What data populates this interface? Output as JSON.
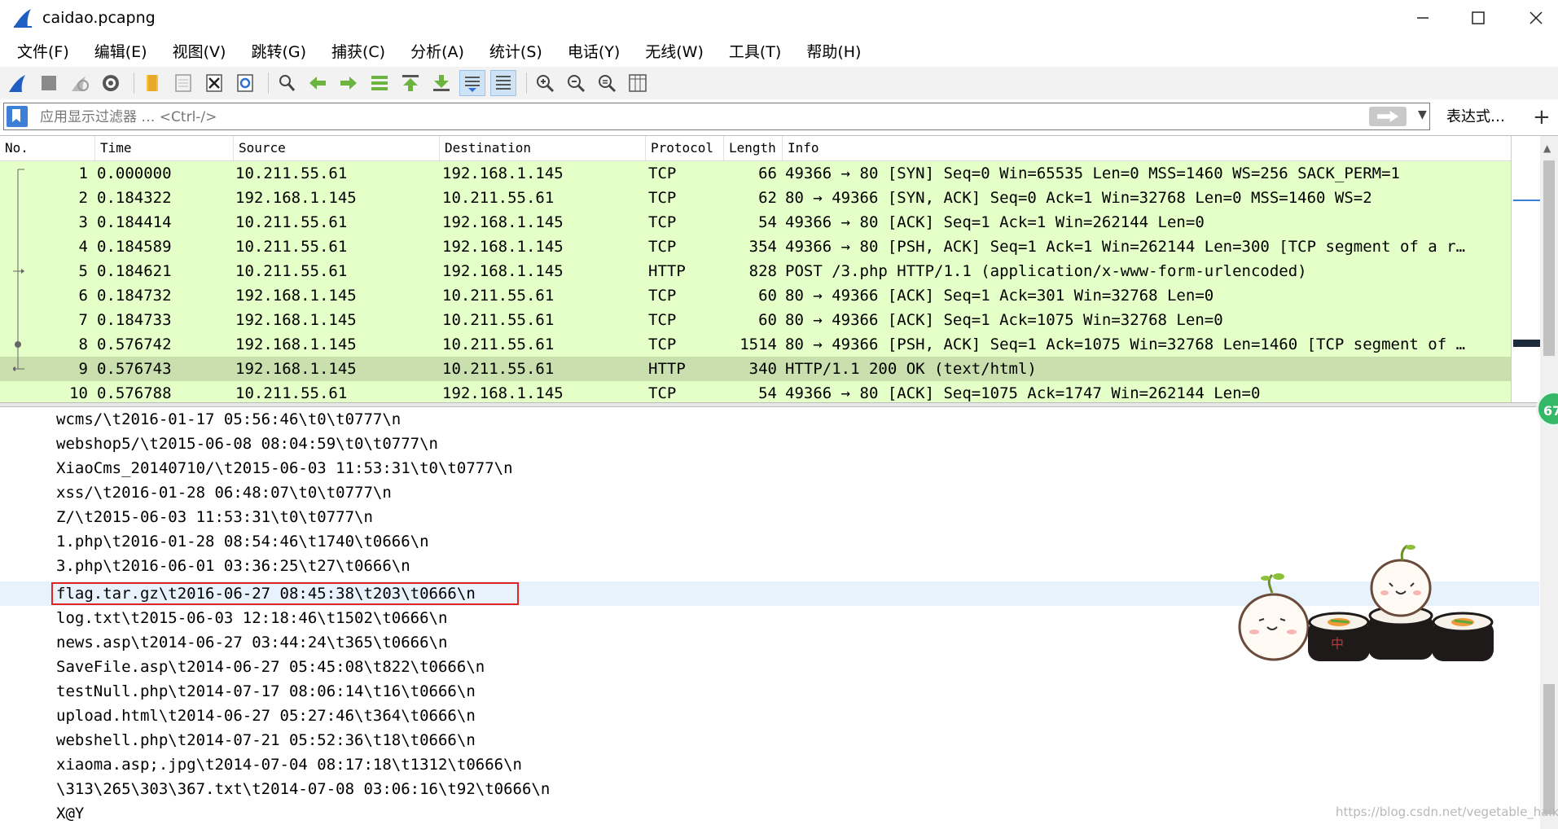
{
  "window": {
    "title": "caidao.pcapng",
    "minimize": "—",
    "maximize": "☐",
    "close": "✕"
  },
  "menu": [
    {
      "label": "文件(F)"
    },
    {
      "label": "编辑(E)"
    },
    {
      "label": "视图(V)"
    },
    {
      "label": "跳转(G)"
    },
    {
      "label": "捕获(C)"
    },
    {
      "label": "分析(A)"
    },
    {
      "label": "统计(S)"
    },
    {
      "label": "电话(Y)"
    },
    {
      "label": "无线(W)"
    },
    {
      "label": "工具(T)"
    },
    {
      "label": "帮助(H)"
    }
  ],
  "toolbar": {
    "icons": [
      "shark-fin-start-icon",
      "stop-capture-icon",
      "restart-capture-icon",
      "capture-options-icon",
      "open-file-icon",
      "save-file-icon",
      "close-file-icon",
      "reload-file-icon",
      "find-packet-icon",
      "go-back-icon",
      "go-forward-icon",
      "go-to-packet-icon",
      "first-packet-icon",
      "last-packet-icon",
      "autoscroll-icon",
      "colorize-icon",
      "zoom-in-icon",
      "zoom-out-icon",
      "zoom-normal-icon",
      "resize-columns-icon"
    ]
  },
  "filter": {
    "placeholder": "应用显示过滤器 … <Ctrl-/>",
    "value": "",
    "expression_label": "表达式…",
    "add_label": "+"
  },
  "packet_list": {
    "columns": [
      "No.",
      "Time",
      "Source",
      "Destination",
      "Protocol",
      "Length",
      "Info"
    ],
    "rows": [
      {
        "no": "1",
        "time": "0.000000",
        "src": "10.211.55.61",
        "dst": "192.168.1.145",
        "proto": "TCP",
        "len": "66",
        "info": "49366 → 80 [SYN] Seq=0 Win=65535 Len=0 MSS=1460 WS=256 SACK_PERM=1"
      },
      {
        "no": "2",
        "time": "0.184322",
        "src": "192.168.1.145",
        "dst": "10.211.55.61",
        "proto": "TCP",
        "len": "62",
        "info": "80 → 49366 [SYN, ACK] Seq=0 Ack=1 Win=32768 Len=0 MSS=1460 WS=2"
      },
      {
        "no": "3",
        "time": "0.184414",
        "src": "10.211.55.61",
        "dst": "192.168.1.145",
        "proto": "TCP",
        "len": "54",
        "info": "49366 → 80 [ACK] Seq=1 Ack=1 Win=262144 Len=0"
      },
      {
        "no": "4",
        "time": "0.184589",
        "src": "10.211.55.61",
        "dst": "192.168.1.145",
        "proto": "TCP",
        "len": "354",
        "info": "49366 → 80 [PSH, ACK] Seq=1 Ack=1 Win=262144 Len=300 [TCP segment of a r…"
      },
      {
        "no": "5",
        "time": "0.184621",
        "src": "10.211.55.61",
        "dst": "192.168.1.145",
        "proto": "HTTP",
        "len": "828",
        "info": "POST /3.php HTTP/1.1  (application/x-www-form-urlencoded)"
      },
      {
        "no": "6",
        "time": "0.184732",
        "src": "192.168.1.145",
        "dst": "10.211.55.61",
        "proto": "TCP",
        "len": "60",
        "info": "80 → 49366 [ACK] Seq=1 Ack=301 Win=32768 Len=0"
      },
      {
        "no": "7",
        "time": "0.184733",
        "src": "192.168.1.145",
        "dst": "10.211.55.61",
        "proto": "TCP",
        "len": "60",
        "info": "80 → 49366 [ACK] Seq=1 Ack=1075 Win=32768 Len=0"
      },
      {
        "no": "8",
        "time": "0.576742",
        "src": "192.168.1.145",
        "dst": "10.211.55.61",
        "proto": "TCP",
        "len": "1514",
        "info": "80 → 49366 [PSH, ACK] Seq=1 Ack=1075 Win=32768 Len=1460 [TCP segment of …"
      },
      {
        "no": "9",
        "time": "0.576743",
        "src": "192.168.1.145",
        "dst": "10.211.55.61",
        "proto": "HTTP",
        "len": "340",
        "info": "HTTP/1.1 200 OK  (text/html)"
      },
      {
        "no": "10",
        "time": "0.576788",
        "src": "10.211.55.61",
        "dst": "192.168.1.145",
        "proto": "TCP",
        "len": "54",
        "info": "49366 → 80 [ACK] Seq=1075 Ack=1747 Win=262144 Len=0"
      }
    ],
    "selected_row_no": "9"
  },
  "text_pane": {
    "lines": [
      "wcms/\\t2016-01-17 05:56:46\\t0\\t0777\\n",
      "webshop5/\\t2015-06-08 08:04:59\\t0\\t0777\\n",
      "XiaoCms_20140710/\\t2015-06-03 11:53:31\\t0\\t0777\\n",
      "xss/\\t2016-01-28 06:48:07\\t0\\t0777\\n",
      "Z/\\t2015-06-03 11:53:31\\t0\\t0777\\n",
      "1.php\\t2016-01-28 08:54:46\\t1740\\t0666\\n",
      "3.php\\t2016-06-01 03:36:25\\t27\\t0666\\n",
      "flag.tar.gz\\t2016-06-27 08:45:38\\t203\\t0666\\n",
      "log.txt\\t2015-06-03 12:18:46\\t1502\\t0666\\n",
      "news.asp\\t2014-06-27 03:44:24\\t365\\t0666\\n",
      "SaveFile.asp\\t2014-06-27 05:45:08\\t822\\t0666\\n",
      "testNull.php\\t2014-07-17 08:06:14\\t16\\t0666\\n",
      "upload.html\\t2014-06-27 05:27:46\\t364\\t0666\\n",
      "webshell.php\\t2014-07-21 05:52:36\\t18\\t0666\\n",
      "xiaoma.asp;.jpg\\t2014-07-04 08:17:18\\t1312\\t0666\\n",
      "\\313\\265\\303\\367.txt\\t2014-07-08 03:06:16\\t92\\t0666\\n",
      "X@Y"
    ],
    "highlighted_index": 7
  },
  "badge": "67",
  "watermark": "https://blog.csdn.net/vegetable_haike",
  "colors": {
    "row_bg": "#e4ffc7",
    "row_selected": "#c9dfad",
    "highlight_border": "#e02424",
    "accent": "#2f6fd1"
  }
}
